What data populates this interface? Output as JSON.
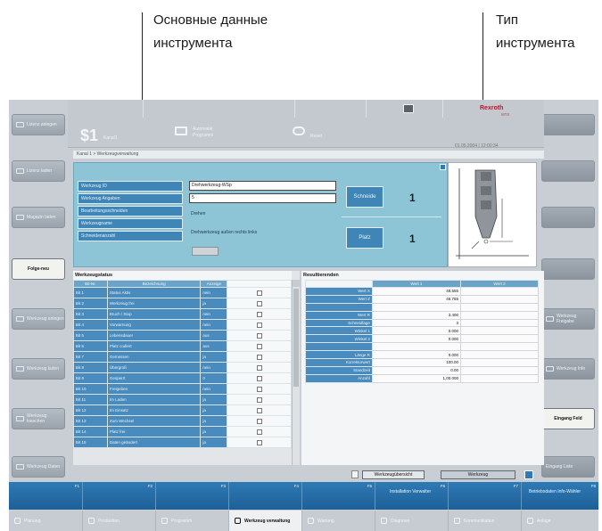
{
  "annotations": {
    "basic_data": [
      "Основные данные",
      "инструмента"
    ],
    "tool_type": [
      "Тип",
      "инструмента"
    ]
  },
  "header": {
    "channel_status": "$1",
    "channel_label": "Kanal1",
    "mode_label_1": "Automatik",
    "mode_label_2": "Programm",
    "reset_label": "Reset",
    "brand": "Rexroth",
    "brand_sub": "MTX",
    "datetime": "01.05.2004 | 12:00:34"
  },
  "breadcrumb": "Kanal 1 > Werkzeugverwaltung",
  "left_softkeys": [
    "Lizenz anlegen",
    "Lizenz laden",
    "Magazin laden",
    "Folge-neu",
    "Werkzeug anlegen",
    "Werkzeug laden",
    "Werkzeug loeschen",
    "Werkzeug Daten"
  ],
  "right_softkeys": [
    "",
    "",
    "",
    "",
    "",
    "Werkzeug Freigabe",
    "Werkzeug Info",
    "Eingang Feld",
    "Eingang Liste"
  ],
  "basic_data": {
    "labels": [
      "Werkzeug ID",
      "Werkzeug Angaben",
      "Bearbeitungsschneiden",
      "Werkzeugname",
      "Schneidenanzahl"
    ],
    "tool_id": "Drehwerkzeug-WSp",
    "tool_info": "5",
    "type_text": "Drehen",
    "name_text": "Drehwerkzeug außen rechts links",
    "edge_label": "Schneide",
    "edge_count": "1",
    "place_label": "Platz",
    "place_count": "1"
  },
  "status_table": {
    "title": "Werkzeugstatus",
    "headers": [
      "Bit-Nr.",
      "Bezeichnung",
      "Anzeige",
      ""
    ],
    "rows": [
      {
        "bit": "Bit 1",
        "name": "Status Aktiv",
        "val": "nein"
      },
      {
        "bit": "Bit 2",
        "name": "Werkzeug frei",
        "val": "ja"
      },
      {
        "bit": "Bit 3",
        "name": "Bruch / Stop",
        "val": "nein"
      },
      {
        "bit": "Bit 4",
        "name": "Vorwarnung",
        "val": "nein"
      },
      {
        "bit": "Bit 5",
        "name": "Lebensdauer",
        "val": "aus"
      },
      {
        "bit": "Bit 6",
        "name": "Platz codiert",
        "val": "aus"
      },
      {
        "bit": "Bit 7",
        "name": "Gemessen",
        "val": "ja"
      },
      {
        "bit": "Bit 8",
        "name": "Übergroß",
        "val": "nein"
      },
      {
        "bit": "Bit 9",
        "name": "Gesperrt",
        "val": "0"
      },
      {
        "bit": "Bit 10",
        "name": "Freigeben",
        "val": "nein"
      },
      {
        "bit": "Bit 11",
        "name": "Im Laden",
        "val": "ja"
      },
      {
        "bit": "Bit 12",
        "name": "Im Einsatz",
        "val": "ja"
      },
      {
        "bit": "Bit 13",
        "name": "Zum Wechsel",
        "val": "ja"
      },
      {
        "bit": "Bit 14",
        "name": "Platz frei",
        "val": "ja"
      },
      {
        "bit": "Bit 15",
        "name": "Daten geändert",
        "val": "ja"
      }
    ]
  },
  "result_table": {
    "title": "Resultierenden",
    "headers": [
      "",
      "Wert 1",
      "Wert 2"
    ],
    "rows": [
      {
        "k": "Wert X",
        "v": "48.555"
      },
      {
        "k": "Wert Z",
        "v": "46.755"
      },
      {
        "k": "",
        "v": ""
      },
      {
        "k": "Wert R",
        "v": "3.400"
      },
      {
        "k": "Schneidlage",
        "v": "3"
      },
      {
        "k": "Winkel 1",
        "v": "0.000"
      },
      {
        "k": "Winkel 2",
        "v": "0.000"
      },
      {
        "k": "",
        "v": ""
      },
      {
        "k": "Länge R",
        "v": "0.000"
      },
      {
        "k": "Korrekturwert",
        "v": "100.00"
      },
      {
        "k": "Standzeit",
        "v": "0.00"
      },
      {
        "k": "Anzahl",
        "v": "1,00.000"
      }
    ]
  },
  "action_buttons": [
    "Werkzeugübersicht",
    "Werkzeug"
  ],
  "bottom_bar": {
    "markers": [
      "F1",
      "F2",
      "F3",
      "F4",
      "F5",
      "F6",
      "F7",
      "F8"
    ],
    "labels": [
      "",
      "",
      "",
      "",
      "",
      "Installation Verwalter",
      "",
      "Betriebsdaten Info-Wähler"
    ]
  },
  "tabs": [
    "Planung",
    "Produktion",
    "Programm",
    "Werkzeug verwaltung",
    "Wartung",
    "Diagnose",
    "Kommunikation",
    "Anlage"
  ],
  "active_tab": 3
}
